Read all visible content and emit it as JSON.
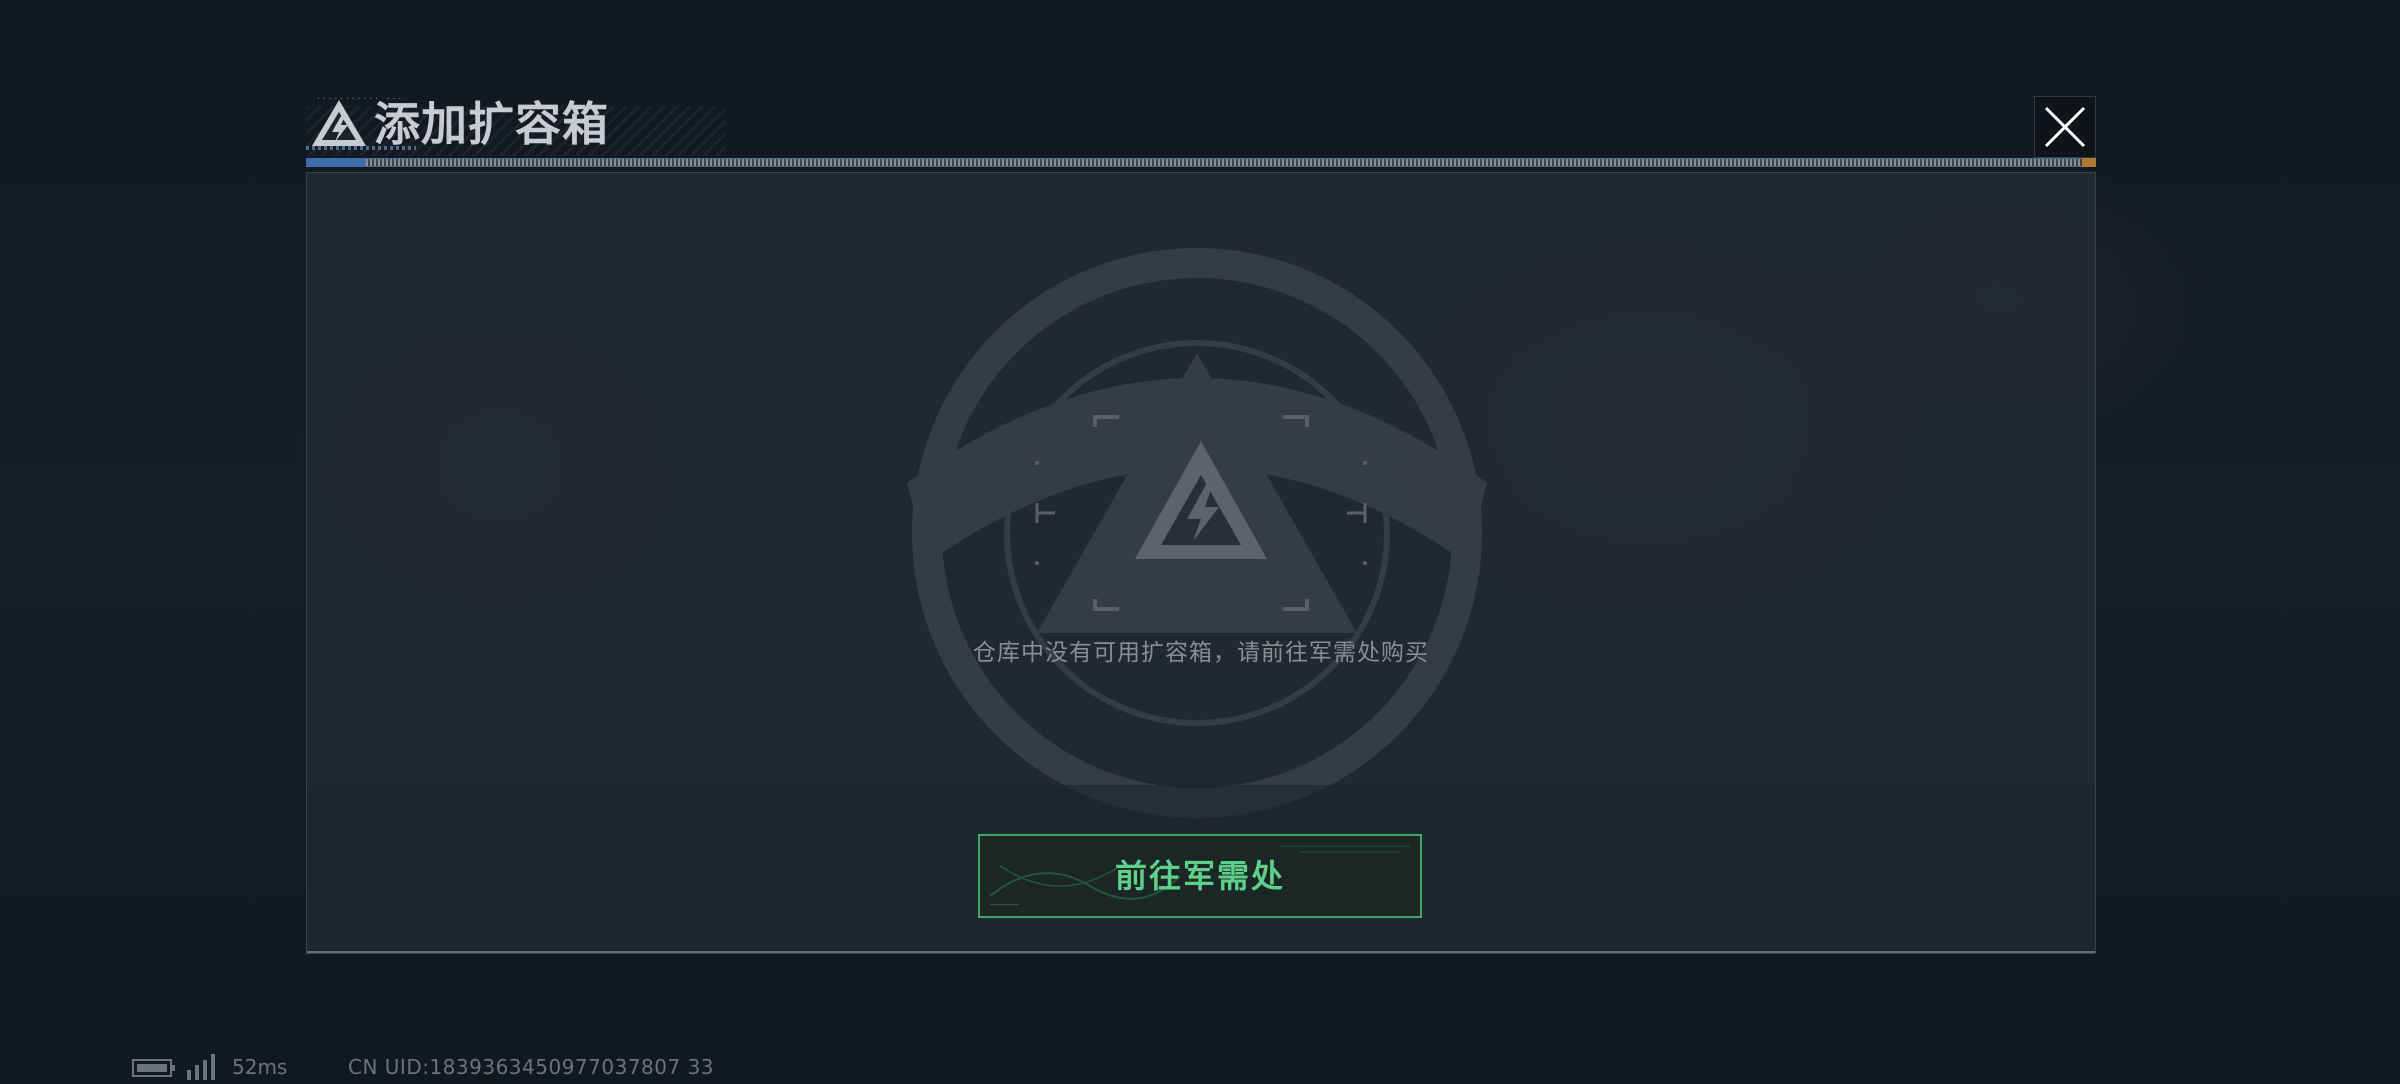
{
  "dialog": {
    "title": "添加扩容箱",
    "header_tag": "··········· ···",
    "empty_message": "仓库中没有可用扩容箱，请前往军需处购买",
    "shop_button_label": "前往军需处",
    "shop_button_tag": "——————",
    "close_icon": "close-icon",
    "logo_icon": "triangle-lightning-logo-icon"
  },
  "status_bar": {
    "latency": "52ms",
    "uid": "CN UID:1839363450977037807 33"
  },
  "colors": {
    "accent_green": "#5fd08a",
    "button_border": "#3ea766",
    "title_text": "#c8cbcf",
    "message_text": "#8a8e93",
    "header_accent_blue": "#3e6ea8",
    "header_accent_orange": "#b0772e"
  }
}
